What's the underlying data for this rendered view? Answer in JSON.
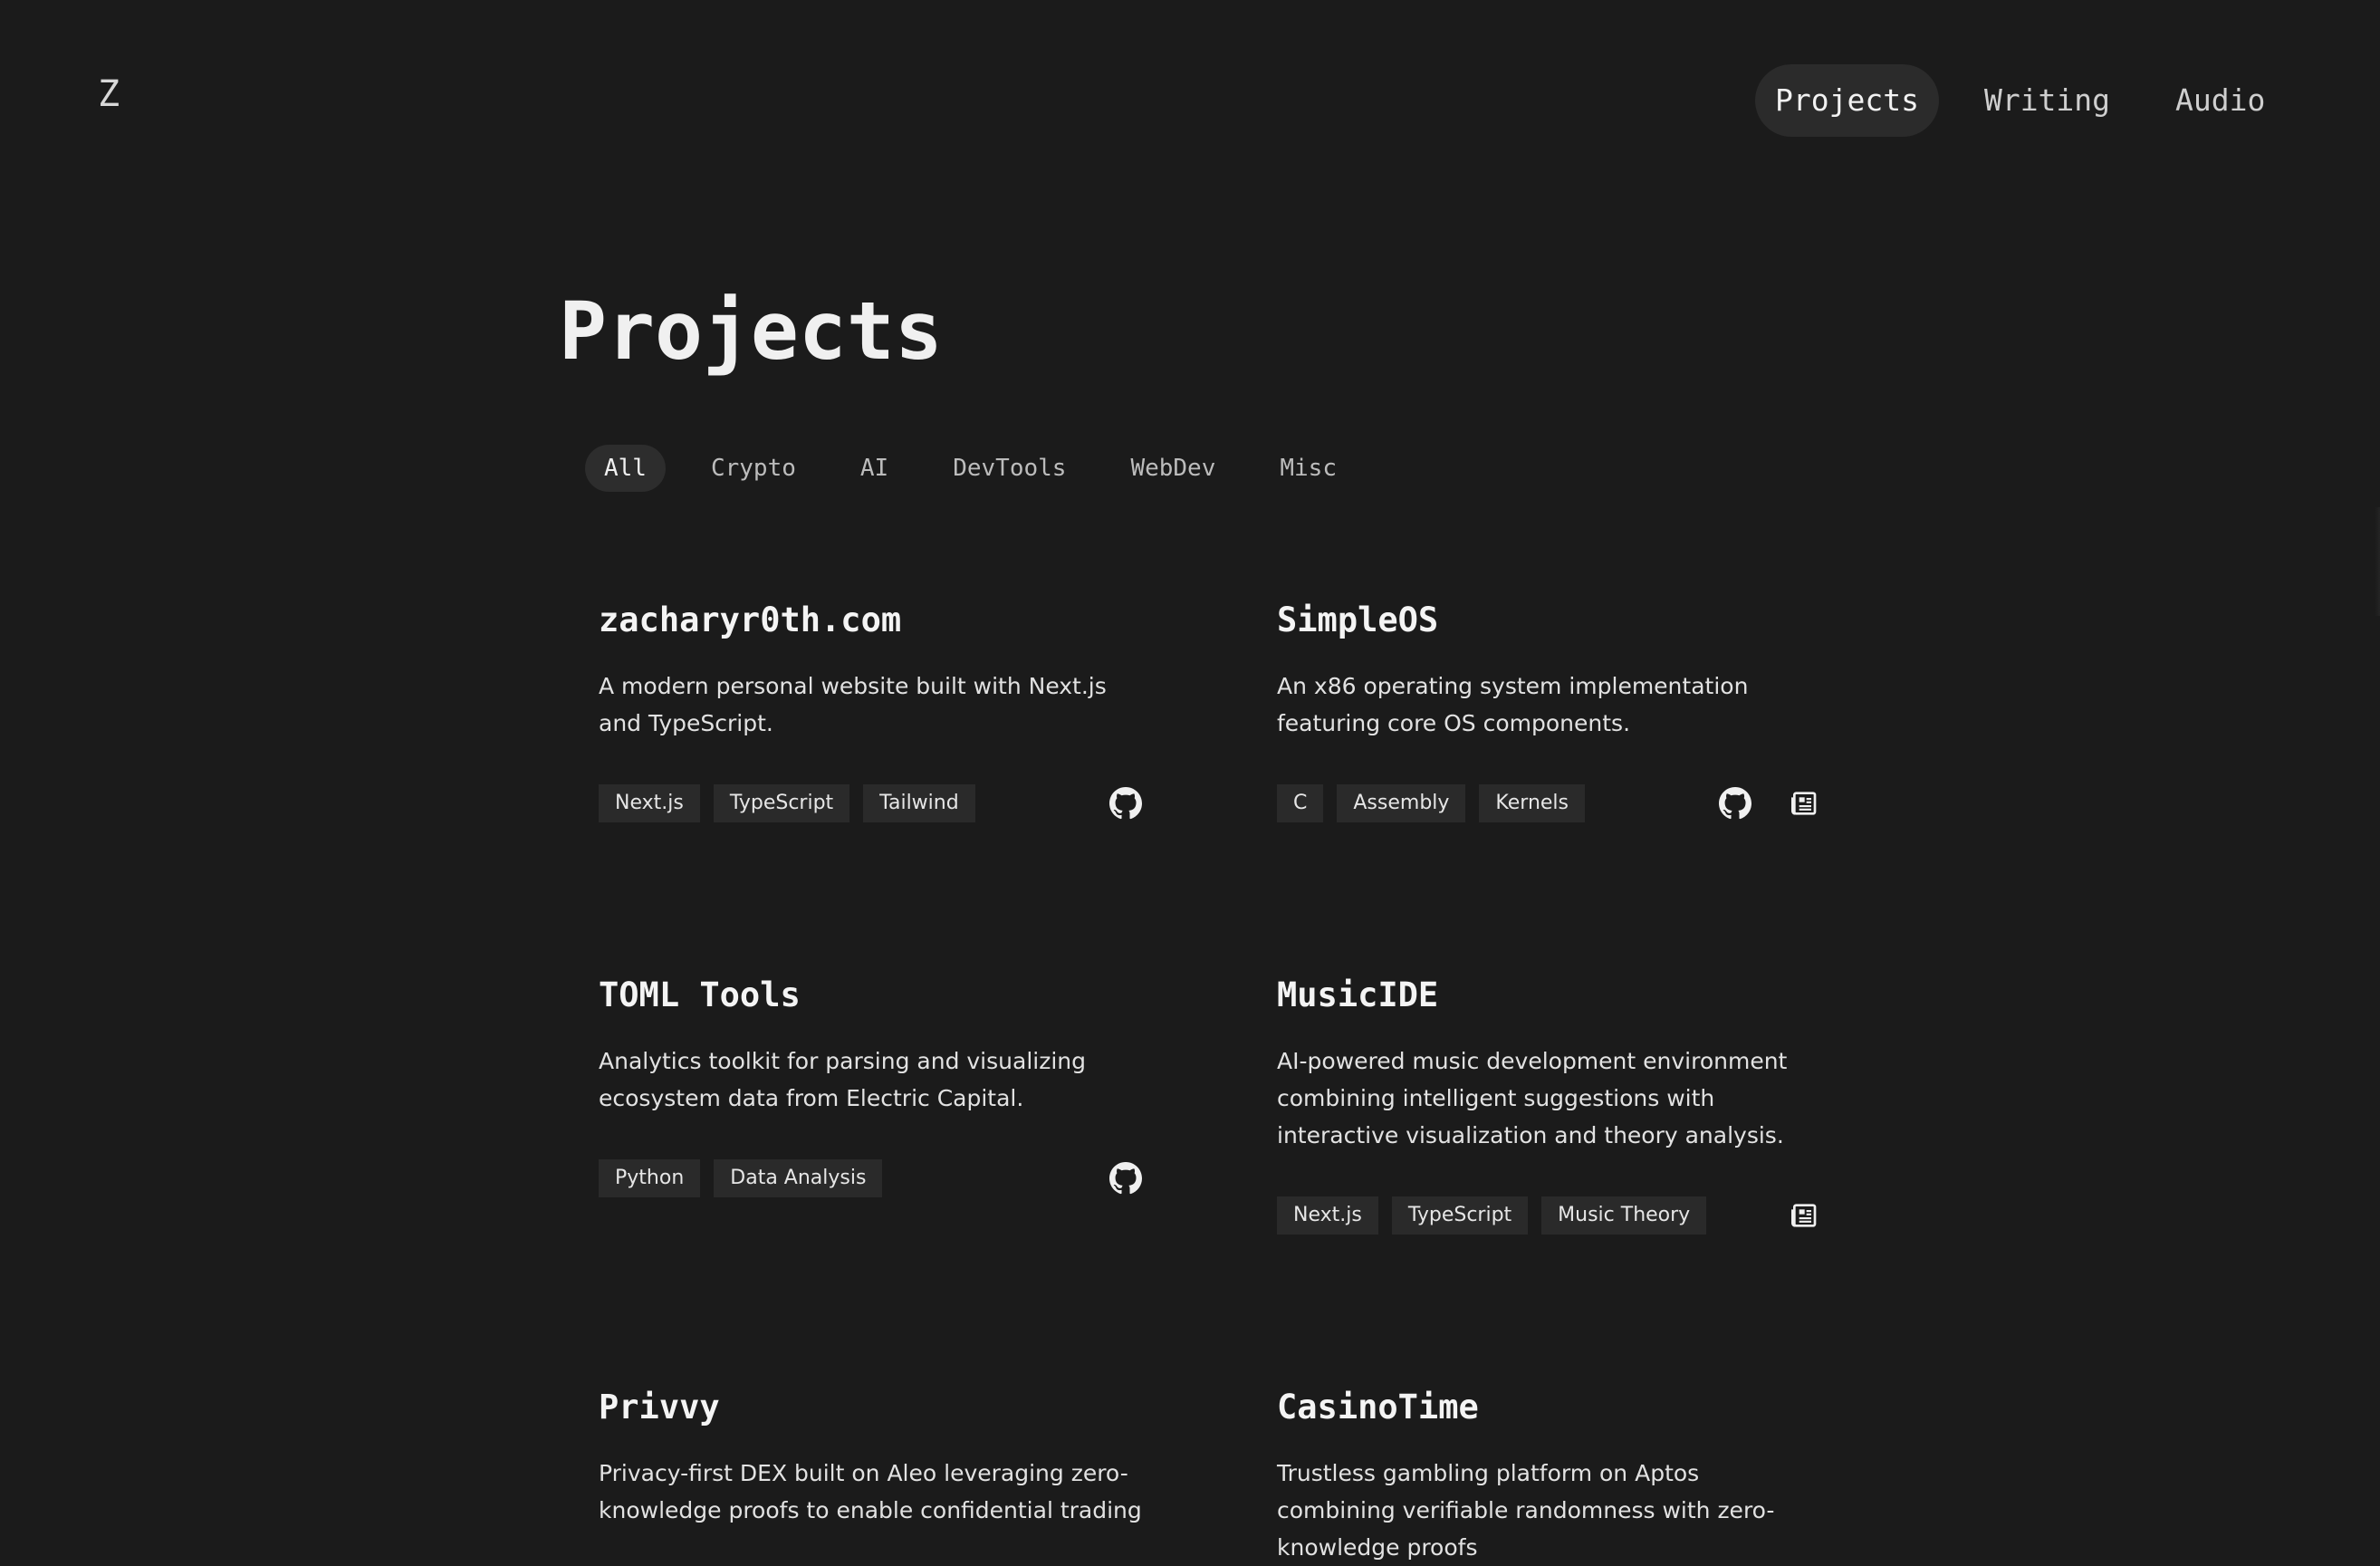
{
  "header": {
    "logo": "Z",
    "nav": [
      {
        "label": "Projects",
        "active": true
      },
      {
        "label": "Writing",
        "active": false
      },
      {
        "label": "Audio",
        "active": false
      }
    ]
  },
  "page": {
    "title": "Projects"
  },
  "filters": [
    {
      "label": "All",
      "active": true
    },
    {
      "label": "Crypto",
      "active": false
    },
    {
      "label": "AI",
      "active": false
    },
    {
      "label": "DevTools",
      "active": false
    },
    {
      "label": "WebDev",
      "active": false
    },
    {
      "label": "Misc",
      "active": false
    }
  ],
  "projects": [
    {
      "title": "zacharyr0th.com",
      "description": "A modern personal website built with Next.js and TypeScript.",
      "tags": [
        "Next.js",
        "TypeScript",
        "Tailwind"
      ],
      "links": [
        "github-icon"
      ]
    },
    {
      "title": "SimpleOS",
      "description": "An x86 operating system implementation featuring core OS components.",
      "tags": [
        "C",
        "Assembly",
        "Kernels"
      ],
      "links": [
        "github-icon",
        "article-icon"
      ]
    },
    {
      "title": "TOML Tools",
      "description": "Analytics toolkit for parsing and visualizing ecosystem data from Electric Capital.",
      "tags": [
        "Python",
        "Data Analysis"
      ],
      "links": [
        "github-icon"
      ]
    },
    {
      "title": "MusicIDE",
      "description": "AI-powered music development environment combining intelligent suggestions with interactive visualization and theory analysis.",
      "tags": [
        "Next.js",
        "TypeScript",
        "Music Theory"
      ],
      "links": [
        "article-icon"
      ]
    },
    {
      "title": "Privvy",
      "description": "Privacy-first DEX built on Aleo leveraging zero-knowledge proofs to enable confidential trading",
      "tags": [],
      "links": []
    },
    {
      "title": "CasinoTime",
      "description": "Trustless gambling platform on Aptos combining verifiable randomness with zero-knowledge proofs",
      "tags": [],
      "links": []
    }
  ],
  "theme": {
    "background": "#1b1b1b",
    "tag_background": "#2a2a2a",
    "active_pill": "#2b2b2b",
    "text": "#f2f2f2"
  }
}
